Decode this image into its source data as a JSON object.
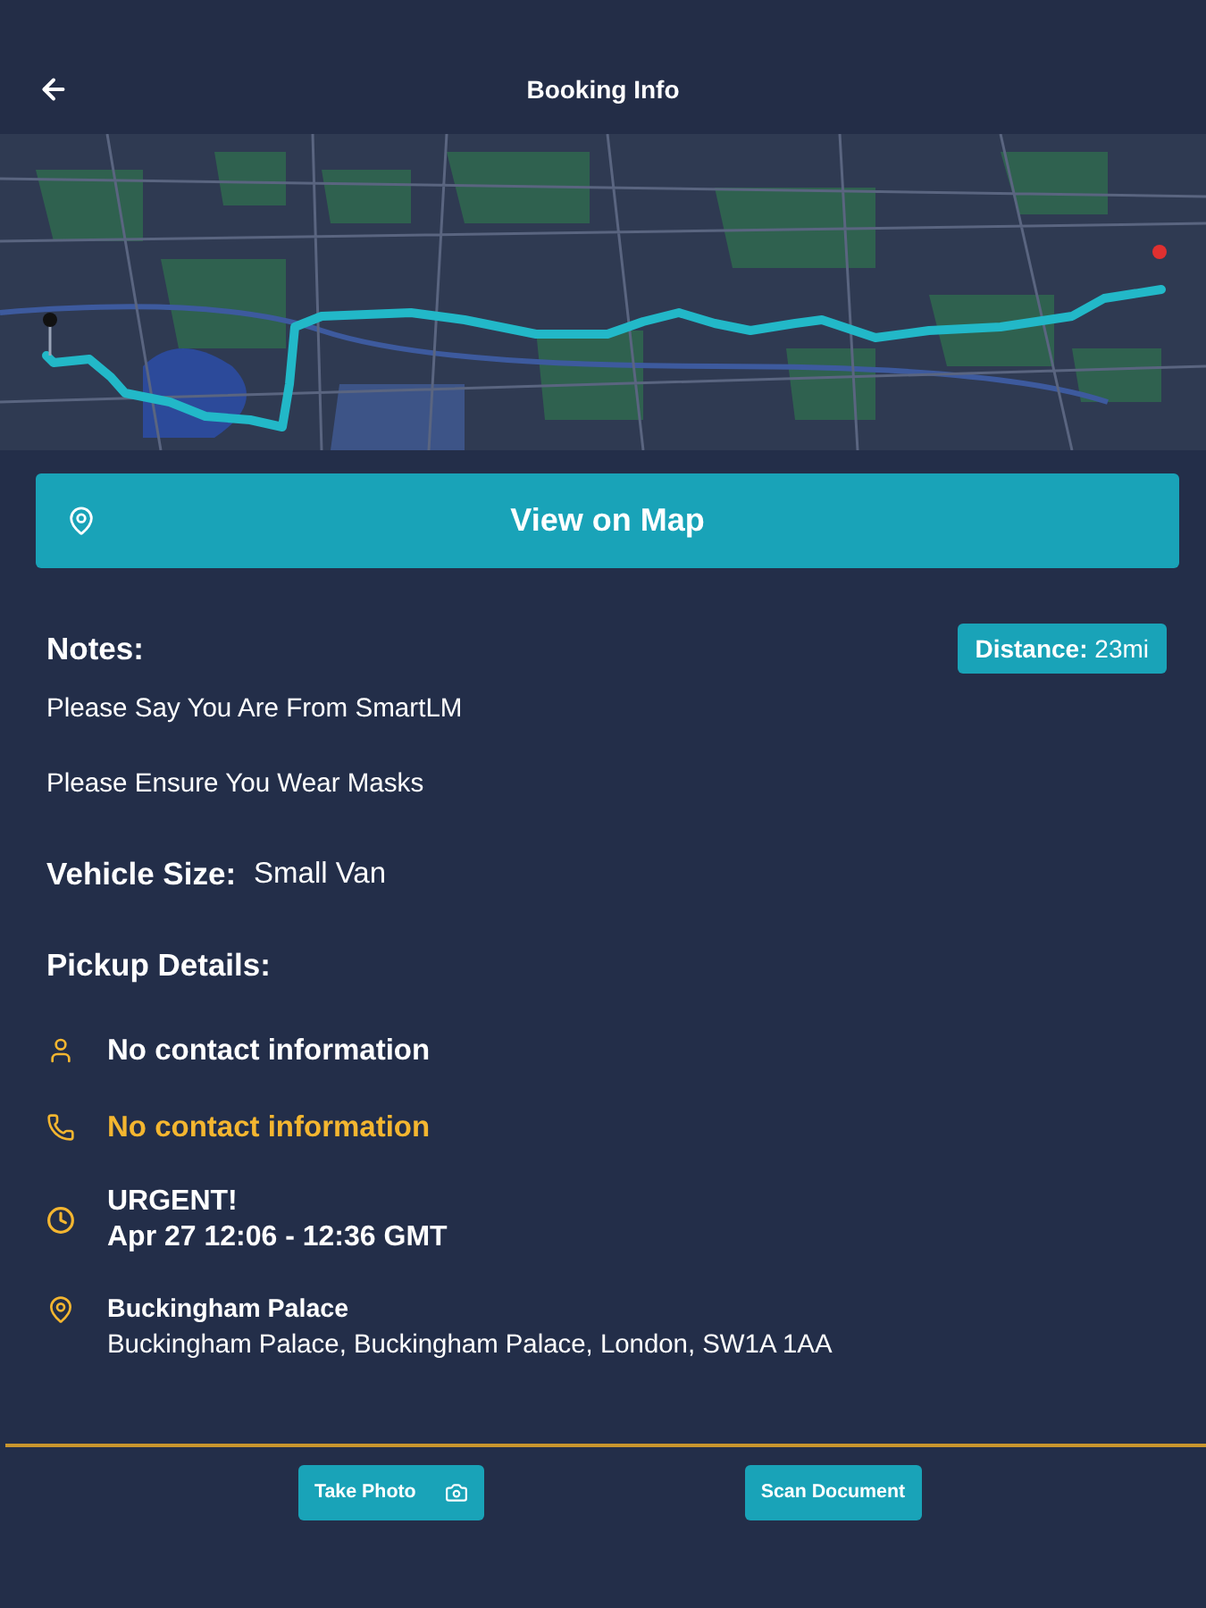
{
  "header": {
    "title": "Booking Info"
  },
  "map": {
    "button": "View on Map"
  },
  "notes": {
    "heading": "Notes:",
    "distance": "**Distance:** 23mi",
    "items": [
      "Please Say You Are From SmartLM",
      "Please Ensure You Wear Masks"
    ]
  },
  "vehicle": {
    "label": "Vehicle Size:",
    "value": "Small Van"
  },
  "pickup": {
    "heading": "Pickup Details:",
    "rows": [
      {
        "kind": "contact",
        "lines": [
          "No contact information"
        ]
      },
      {
        "kind": "phone",
        "lines": [
          "No contact information"
        ]
      },
      {
        "kind": "time",
        "lines": [
          "URGENT!",
          "Apr 27 12:06 - 12:36 GMT"
        ]
      },
      {
        "kind": "location",
        "lines": [
          "Buckingham Palace",
          "Buckingham Palace, Buckingham Palace, London, SW1A 1AA"
        ]
      }
    ]
  },
  "actions": [
    {
      "label": "Take Photo",
      "kind": "photo"
    },
    {
      "label": "Scan Document",
      "kind": "scan"
    }
  ]
}
